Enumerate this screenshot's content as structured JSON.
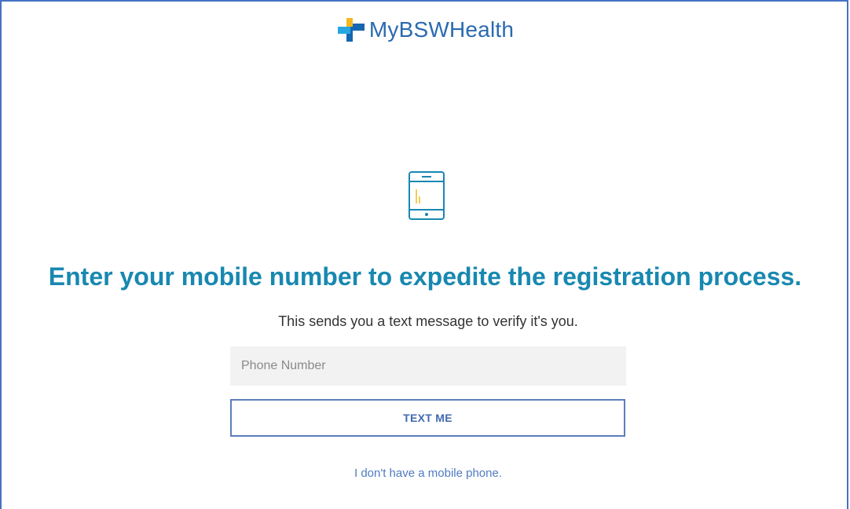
{
  "brand": {
    "name": "MyBSWHealth",
    "logo_icon": "bsw-cross-logo-icon",
    "text_color": "#2a6ab0"
  },
  "main": {
    "illustration_icon": "mobile-phone-icon",
    "headline": "Enter your mobile number to expedite the registration process.",
    "subtext": "This sends you a text message to verify it's you.",
    "phone_input": {
      "value": "",
      "placeholder": "Phone Number"
    },
    "text_me_button": "TEXT ME",
    "no_mobile_link": "I don't have a mobile phone."
  },
  "colors": {
    "headline": "#1888b0",
    "button_border": "#5b7dbc",
    "link": "#4f7bc0",
    "input_bg": "#f2f2f2",
    "logo_yellow": "#f5b820",
    "logo_blue": "#1565b0",
    "logo_light_blue": "#27a7e0"
  }
}
